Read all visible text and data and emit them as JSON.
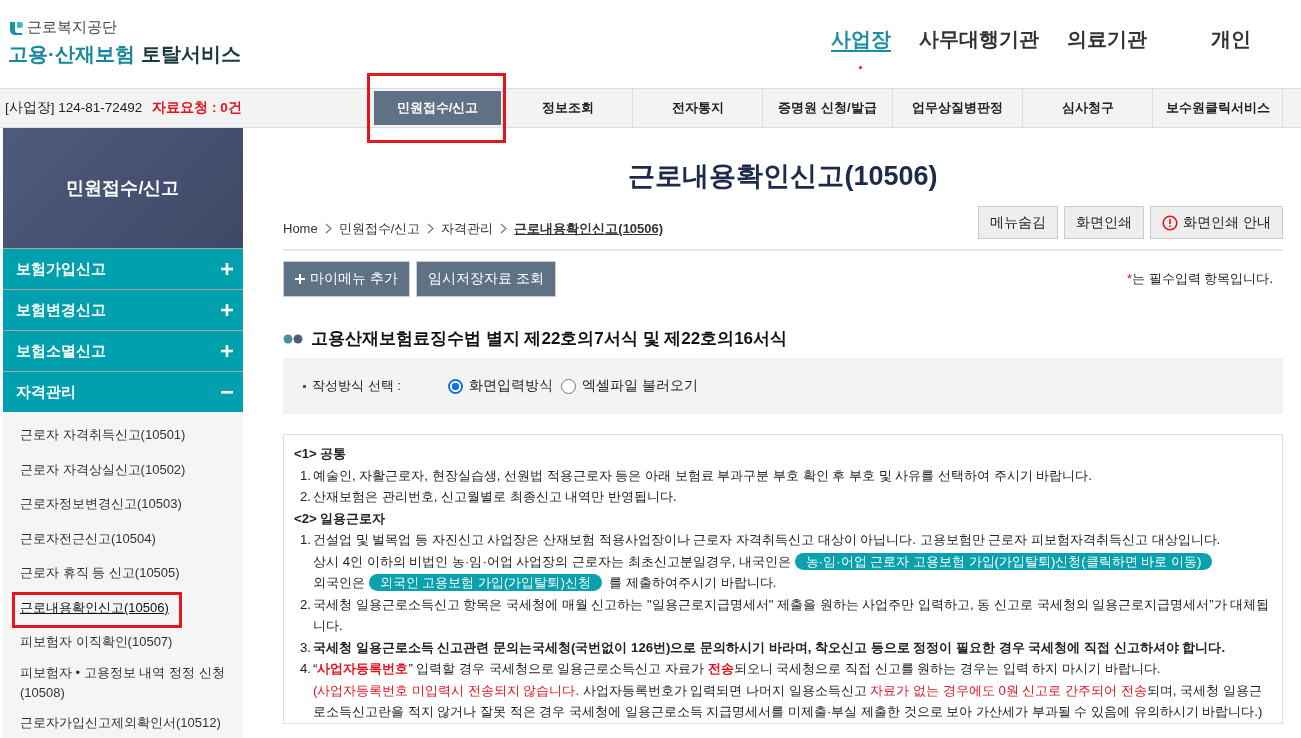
{
  "header": {
    "org": "근로복지공단",
    "title_main": "고용·산재보험",
    "title_sub": "토탈서비스",
    "nav": [
      {
        "label": "사업장",
        "selected": true
      },
      {
        "label": "사무대행기관",
        "selected": false
      },
      {
        "label": "의료기관",
        "selected": false
      },
      {
        "label": "개인",
        "selected": false
      }
    ]
  },
  "infobar": {
    "site": "[사업장] 124-81-72492",
    "request": "자료요청 : 0건"
  },
  "menu": [
    {
      "label": "민원접수/신고",
      "selected": true,
      "highlighted": true
    },
    {
      "label": "정보조회",
      "selected": false,
      "highlighted": false
    },
    {
      "label": "전자통지",
      "selected": false,
      "highlighted": false
    },
    {
      "label": "증명원 신청/발급",
      "selected": false,
      "highlighted": false
    },
    {
      "label": "업무상질병판정",
      "selected": false,
      "highlighted": false
    },
    {
      "label": "심사청구",
      "selected": false,
      "highlighted": false
    },
    {
      "label": "보수원클릭서비스",
      "selected": false,
      "highlighted": false
    }
  ],
  "sidebar": {
    "title": "민원접수/신고",
    "groups": [
      {
        "label": "보험가입신고",
        "expanded": false
      },
      {
        "label": "보험변경신고",
        "expanded": false
      },
      {
        "label": "보험소멸신고",
        "expanded": false
      },
      {
        "label": "자격관리",
        "expanded": true,
        "children": [
          {
            "label": "근로자 자격취득신고(10501)",
            "selected": false,
            "highlighted": false
          },
          {
            "label": "근로자 자격상실신고(10502)",
            "selected": false,
            "highlighted": false
          },
          {
            "label": "근로자정보변경신고(10503)",
            "selected": false,
            "highlighted": false
          },
          {
            "label": "근로자전근신고(10504)",
            "selected": false,
            "highlighted": false
          },
          {
            "label": "근로자 휴직 등 신고(10505)",
            "selected": false,
            "highlighted": false
          },
          {
            "label": "근로내용확인신고(10506)",
            "selected": true,
            "highlighted": true
          },
          {
            "label": "피보험자 이직확인(10507)",
            "selected": false,
            "highlighted": false
          },
          {
            "label": "피보험자 • 고용정보 내역 정정 신청(10508)",
            "selected": false,
            "highlighted": false
          },
          {
            "label": "근로자가입신고제외확인서(10512)",
            "selected": false,
            "highlighted": false
          }
        ]
      }
    ]
  },
  "page": {
    "title": "근로내용확인신고(10506)",
    "breadcrumb": [
      "Home",
      "민원접수/신고",
      "자격관리",
      "근로내용확인신고(10506)"
    ],
    "tools": [
      {
        "label": "메뉴숨김",
        "kind": "plain"
      },
      {
        "label": "화면인쇄",
        "kind": "plain"
      },
      {
        "label": "화면인쇄 안내",
        "kind": "info"
      }
    ],
    "actions": [
      {
        "label": "마이메뉴 추가",
        "kind": "add"
      },
      {
        "label": "임시저장자료 조회",
        "kind": "plain"
      }
    ],
    "required_note": {
      "mark": "*",
      "text": "는 필수입력 항목입니다."
    },
    "section_title": "고용산재보험료징수법 별지 제22호의7서식 및 제22호의16서식",
    "option": {
      "label": "작성방식 선택 :",
      "radios": [
        {
          "label": "화면입력방식",
          "selected": true
        },
        {
          "label": "엑셀파일 불러오기",
          "selected": false
        }
      ]
    },
    "notes": [
      {
        "kind": "heading",
        "text": "<1> 공통"
      },
      {
        "kind": "item",
        "number": "1.",
        "segments": [
          {
            "kind": "text",
            "text": "예술인, 자활근로자, 현장실습생, 선원법 적용근로자 등은 아래 보험료 부과구분 부호 확인 후 부호 및 사유를 선택하여 주시기 바랍니다."
          }
        ]
      },
      {
        "kind": "item",
        "number": "2.",
        "segments": [
          {
            "kind": "text",
            "text": "산재보험은 관리번호, 신고월별로 최종신고 내역만 반영됩니다."
          }
        ]
      },
      {
        "kind": "heading",
        "text": "<2> 일용근로자"
      },
      {
        "kind": "item",
        "number": "1.",
        "segments": [
          {
            "kind": "text",
            "text": "건설업 및 벌목업 등 자진신고 사업장은 산재보험 적용사업장이나 근로자 자격취득신고 대상이 아닙니다. 고용보험만 근로자 피보험자격취득신고 대상입니다."
          },
          {
            "kind": "break"
          },
          {
            "kind": "text",
            "text": "상시 4인 이하의 비법인 농·임·어업 사업장의 근로자는 최초신고분일경우, 내국인은 "
          },
          {
            "kind": "link",
            "text": "농·임·어업 근로자 고용보험 가입(가입탈퇴)신청(클릭하면 바로 이동)"
          },
          {
            "kind": "break"
          },
          {
            "kind": "text",
            "text": "외국인은 "
          },
          {
            "kind": "link",
            "text": "외국인 고용보험 가입(가입탈퇴)신청"
          },
          {
            "kind": "text",
            "text": " 를 제출하여주시기 바랍니다."
          }
        ]
      },
      {
        "kind": "item",
        "number": "2.",
        "segments": [
          {
            "kind": "text",
            "text": "국세청 일용근로소득신고 항목은 국세청에 매월 신고하는 \"일용근로지급명세서\" 제출을 원하는 사업주만 입력하고, 동 신고로 국세청의 일용근로지급명세서”가 대체됩니다."
          }
        ]
      },
      {
        "kind": "item",
        "number": "3.",
        "segments": [
          {
            "kind": "bold",
            "text": "국세청 일용근로소득 신고관련 문의는국세청(국번없이 126번)으로 문의하시기 바라며, 착오신고 등으로 정정이 필요한 경우 국세청에 직접 신고하셔야 합니다."
          }
        ]
      },
      {
        "kind": "item",
        "number": "4.",
        "segments": [
          {
            "kind": "text",
            "text": "“"
          },
          {
            "kind": "alert-bold",
            "text": "사업자등록번호"
          },
          {
            "kind": "text",
            "text": "” 입력할 경우 국세청으로 일용근로소득신고 자료가 "
          },
          {
            "kind": "alert-bold",
            "text": "전송"
          },
          {
            "kind": "text",
            "text": "되오니 국세청으로 직접 신고를 원하는 경우는 입력 하지 마시기 바랍니다."
          },
          {
            "kind": "break"
          },
          {
            "kind": "alert",
            "text": "(사업자등록번호 미입력시 전송되지 않습니다."
          },
          {
            "kind": "text",
            "text": " 사업자등록번호가 입력되면 나머지 일용소득신고 "
          },
          {
            "kind": "alert",
            "text": "자료가 없는 경우에도 0원 신고로 간주되어 전송"
          },
          {
            "kind": "text",
            "text": "되며, 국세청 일용근로소득신고란을 적지 않거나 잘못 적은 경우 국세청에 일용근로소득 지급명세서를 미제출·부실 제출한 것으로 보아 가산세가 부과될 수 있음에 유의하시기 바랍니다.)"
          }
        ]
      }
    ]
  }
}
